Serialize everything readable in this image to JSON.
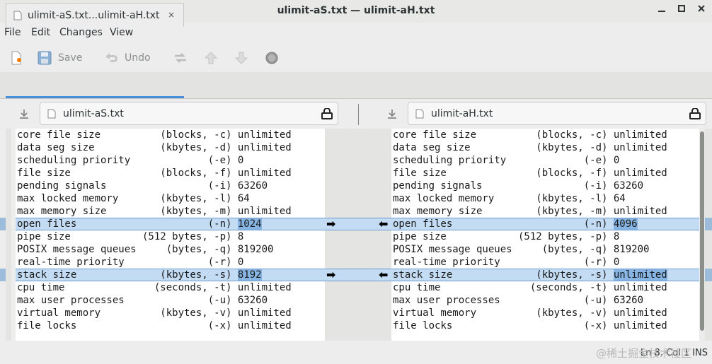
{
  "window": {
    "title": "ulimit-aS.txt — ulimit-aH.txt"
  },
  "menu": [
    "File",
    "Edit",
    "Changes",
    "View"
  ],
  "toolbar": {
    "save_label": "Save",
    "undo_label": "Undo"
  },
  "tab": {
    "label": "ulimit-aS.txt...ulimit-aH.txt",
    "close": "×"
  },
  "left_file": {
    "name": "ulimit-aS.txt"
  },
  "right_file": {
    "name": "ulimit-aH.txt"
  },
  "left_lines": [
    "core file size          (blocks, -c) unlimited",
    "data seg size           (kbytes, -d) unlimited",
    "scheduling priority             (-e) 0",
    "file size               (blocks, -f) unlimited",
    "pending signals                 (-i) 63260",
    "max locked memory       (kbytes, -l) 64",
    "max memory size         (kbytes, -m) unlimited",
    "open files                      (-n) ",
    "pipe size            (512 bytes, -p) 8",
    "POSIX message queues     (bytes, -q) 819200",
    "real-time priority              (-r) 0",
    "stack size              (kbytes, -s) ",
    "cpu time               (seconds, -t) unlimited",
    "max user processes              (-u) 63260",
    "virtual memory          (kbytes, -v) unlimited",
    "file locks                      (-x) unlimited"
  ],
  "right_lines": [
    "core file size          (blocks, -c) unlimited",
    "data seg size           (kbytes, -d) unlimited",
    "scheduling priority             (-e) 0",
    "file size               (blocks, -f) unlimited",
    "pending signals                 (-i) 63260",
    "max locked memory       (kbytes, -l) 64",
    "max memory size         (kbytes, -m) unlimited",
    "open files                      (-n) ",
    "pipe size            (512 bytes, -p) 8",
    "POSIX message queues     (bytes, -q) 819200",
    "real-time priority              (-r) 0",
    "stack size              (kbytes, -s) ",
    "cpu time               (seconds, -t) unlimited",
    "max user processes              (-u) 63260",
    "virtual memory          (kbytes, -v) unlimited",
    "file locks                      (-x) unlimited"
  ],
  "changed": {
    "left_open_files": "1024",
    "right_open_files": "4096",
    "left_stack_size": "8192",
    "right_stack_size": "unlimited"
  },
  "arrows": {
    "right": "➡",
    "left": "⬅"
  },
  "status": {
    "position": "Ln 8, Col 1",
    "mode": "INS"
  },
  "watermark": "@稀土掘金技术社区",
  "colors": {
    "highlight": "#c4dcf3",
    "changed_text_bg": "#87b5e3",
    "tab_accent": "#4a90d9"
  }
}
